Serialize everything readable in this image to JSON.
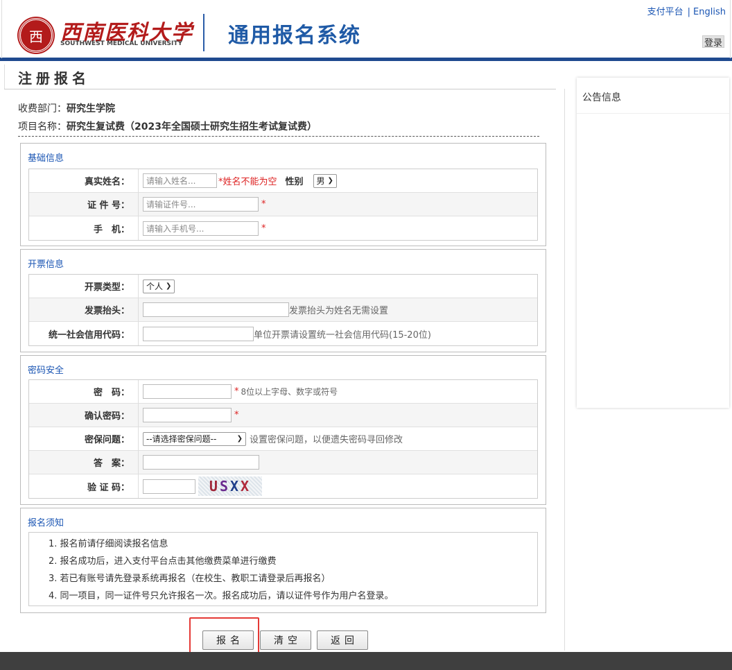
{
  "header": {
    "emblem_char": "西",
    "logo_cn": "西南医科大学",
    "logo_en": "SOUTHWEST MEDICAL UNIVERSITY",
    "system_title": "通用报名系统",
    "links": {
      "pay": "支付平台",
      "sep": "|",
      "english": "English"
    },
    "login": "登录"
  },
  "page": {
    "title": "注册报名",
    "dept_label": "收费部门：",
    "dept_value": "研究生学院",
    "project_label": "项目名称：",
    "project_value": "研究生复试费（2023年全国硕士研究生招生考试复试费）"
  },
  "basic": {
    "title": "基础信息",
    "name_label": "真实姓名：",
    "name_placeholder": "请输入姓名...",
    "name_error": "*姓名不能为空",
    "gender_label": "性别",
    "gender_value": "男",
    "id_label": "证 件 号：",
    "id_placeholder": "请输证件号...",
    "phone_label": "手　机：",
    "phone_placeholder": "请输入手机号...",
    "required": "*"
  },
  "invoice": {
    "title": "开票信息",
    "type_label": "开票类型：",
    "type_value": "个人",
    "header_label": "发票抬头：",
    "header_hint": "发票抬头为姓名无需设置",
    "credit_label": "统一社会信用代码：",
    "credit_hint": "单位开票请设置统一社会信用代码(15-20位)"
  },
  "security": {
    "title": "密码安全",
    "pwd_label": "密　码：",
    "pwd_hint": "8位以上字母、数字或符号",
    "confirm_label": "确认密码：",
    "question_label": "密保问题：",
    "question_value": "--请选择密保问题--",
    "question_hint": "设置密保问题，以便遗失密码寻回修改",
    "answer_label": "答　案：",
    "captcha_label": "验 证 码：",
    "captcha_chars": [
      "U",
      "S",
      "X",
      "X"
    ],
    "required": "*"
  },
  "notice": {
    "title": "报名须知",
    "items": [
      "1. 报名前请仔细阅读报名信息",
      "2. 报名成功后，进入支付平台点击其他缴费菜单进行缴费",
      "3. 若已有账号请先登录系统再报名（在校生、教职工请登录后再报名）",
      "4. 同一项目，同一证件号只允许报名一次。报名成功后，请以证件号作为用户名登录。"
    ]
  },
  "side": {
    "title": "公告信息"
  },
  "actions": {
    "submit": "报名",
    "clear": "清空",
    "back": "返回"
  },
  "colors": {
    "brand_blue": "#1f4a8f",
    "link_blue": "#1a55b3",
    "logo_red": "#b31b1b",
    "highlight_red": "#e53935"
  }
}
